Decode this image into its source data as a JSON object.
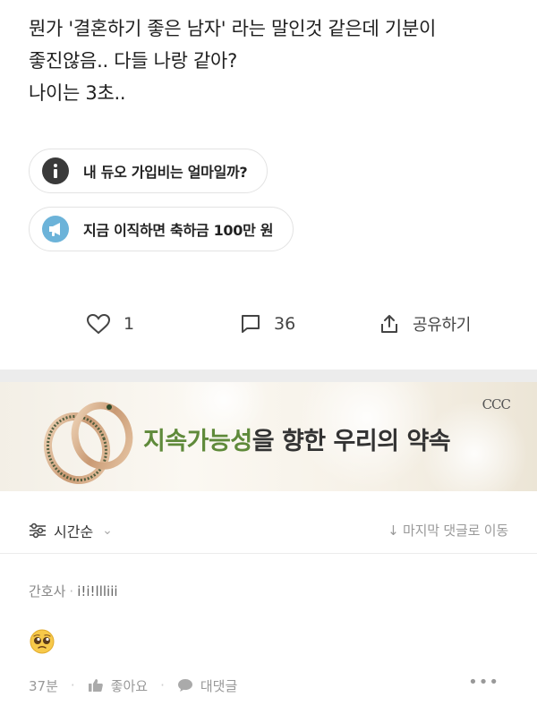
{
  "post": {
    "lines": [
      "뭔가 '결혼하기 좋은 남자' 라는 말인것 같은데 기분이",
      "좋진않음.. 다들 나랑 같아?",
      "나이는 3초.."
    ]
  },
  "pills": [
    {
      "label": "내 듀오 가입비는 얼마일까?",
      "icon": "info-icon",
      "color": "#3a3a3a"
    },
    {
      "label": "지금 이직하면 축하금 100만 원",
      "icon": "megaphone-icon",
      "color": "#6cb3d9"
    }
  ],
  "actions": {
    "like_count": "1",
    "comment_count": "36",
    "share_label": "공유하기"
  },
  "banner": {
    "accent_text": "지속가능성",
    "rest_text": "을 향한 우리의 약속",
    "logo_text": "CCC",
    "accent_color": "#5f8a3a"
  },
  "sort": {
    "order_label": "시간순",
    "jump_label": "↓ 마지막 댓글로 이동"
  },
  "comment": {
    "author": "간호사",
    "nickname": "i!i!llliii",
    "emoji": "pleading-face",
    "time": "37분",
    "like_label": "좋아요",
    "reply_label": "대댓글",
    "more": "•••"
  }
}
